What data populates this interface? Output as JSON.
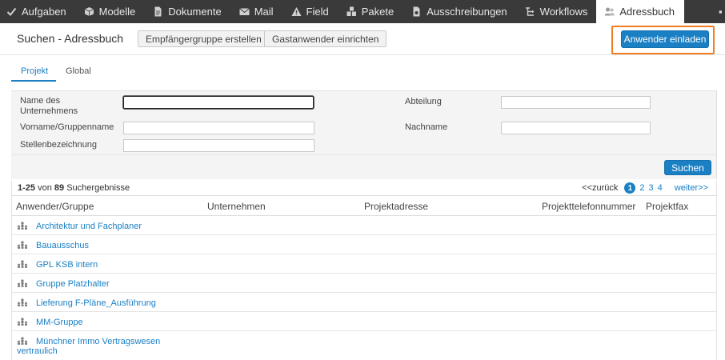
{
  "nav": {
    "items": [
      {
        "label": "Aufgaben",
        "icon": "checkmark-icon"
      },
      {
        "label": "Modelle",
        "icon": "cube-icon"
      },
      {
        "label": "Dokumente",
        "icon": "document-icon"
      },
      {
        "label": "Mail",
        "icon": "mail-icon"
      },
      {
        "label": "Field",
        "icon": "warning-triangle-icon"
      },
      {
        "label": "Pakete",
        "icon": "packages-icon"
      },
      {
        "label": "Ausschreibungen",
        "icon": "tender-document-icon"
      },
      {
        "label": "Workflows",
        "icon": "workflow-icon"
      },
      {
        "label": "Adressbuch",
        "icon": "address-book-icon"
      }
    ],
    "active_index": 8
  },
  "header": {
    "title": "Suchen - Adressbuch",
    "create_group_label": "Empfängergruppe erstellen",
    "guest_user_label": "Gastanwender einrichten",
    "invite_label": "Anwender einladen",
    "highlight_color": "#ef7d22"
  },
  "tabs": [
    {
      "label": "Projekt",
      "active": true
    },
    {
      "label": "Global",
      "active": false
    }
  ],
  "form": {
    "company_label": "Name des Unternehmens",
    "company_value": "",
    "department_label": "Abteilung",
    "department_value": "",
    "firstname_label": "Vorname/Gruppenname",
    "firstname_value": "",
    "lastname_label": "Nachname",
    "lastname_value": "",
    "jobtitle_label": "Stellenbezeichnung",
    "jobtitle_value": "",
    "search_label": "Suchen"
  },
  "results": {
    "range": "1-25",
    "von": "von",
    "total": "89",
    "suffix": "Suchergebnisse",
    "pager": {
      "prev": "<<zurück",
      "current": "1",
      "pages": [
        "2",
        "3",
        "4"
      ],
      "next": "weiter>>"
    },
    "columns": [
      "Anwender/Gruppe",
      "Unternehmen",
      "Projektadresse",
      "Projekttelefonnummer",
      "Projektfax"
    ],
    "rows": [
      {
        "name": "Architektur und Fachplaner"
      },
      {
        "name": "Bauausschus"
      },
      {
        "name": "GPL KSB intern"
      },
      {
        "name": "Gruppe Platzhalter"
      },
      {
        "name": "Lieferung F-Pläne_Ausführung"
      },
      {
        "name": "MM-Gruppe"
      },
      {
        "name": "Münchner Immo Vertragswesen vertraulich"
      }
    ]
  },
  "colors": {
    "accent": "#1b7fc4",
    "nav_background": "#3a3a3a",
    "form_background": "#f4f4f4"
  }
}
